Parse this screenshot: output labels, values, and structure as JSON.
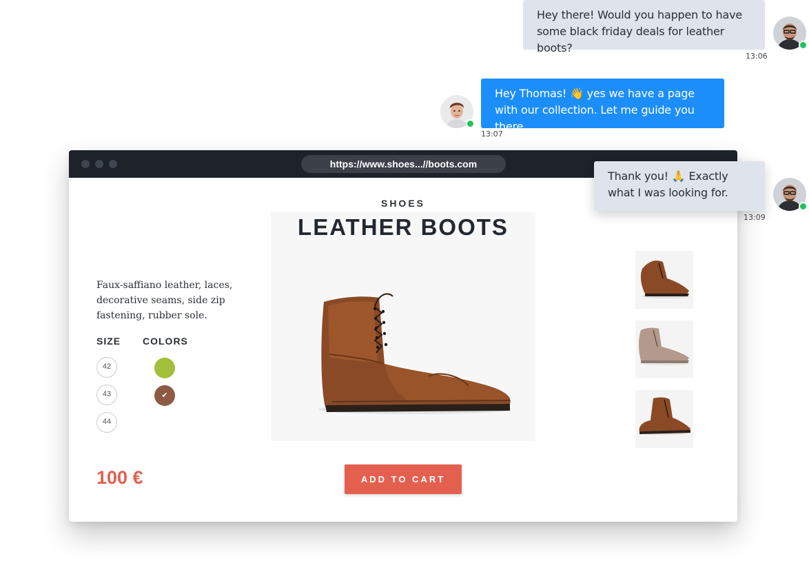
{
  "chat": {
    "messages": [
      {
        "text": "Hey there! Would you happen to have some black friday deals for leather boots?",
        "time": "13:06",
        "sender": "customer"
      },
      {
        "text": "Hey Thomas! 👋 yes we have a page with our collection. Let me guide you there.",
        "time": "13:07",
        "sender": "agent"
      },
      {
        "text": "Thank you! 🙏 Exactly what I was looking for.",
        "time": "13:09",
        "sender": "customer"
      }
    ]
  },
  "browser": {
    "url": "https://www.shoes...//boots.com"
  },
  "product": {
    "category": "SHOES",
    "title": "LEATHER BOOTS",
    "description": "Faux-saffiano leather, laces, decorative seams, side zip fastening, rubber sole.",
    "size_label": "SIZE",
    "colors_label": "COLORS",
    "sizes": [
      "42",
      "43",
      "44"
    ],
    "colors": [
      {
        "name": "green",
        "hex": "#a2c03b",
        "selected": false
      },
      {
        "name": "brown",
        "hex": "#8e5a44",
        "selected": true
      }
    ],
    "check_glyph": "✔",
    "price": "100 €",
    "add_to_cart_label": "ADD TO CART"
  },
  "theme": {
    "accent": "#e3604f",
    "chat_blue": "#1c8ef9",
    "chat_gray": "#dfe3ec",
    "online": "#20c35b",
    "browser_bar": "#1d222b"
  }
}
